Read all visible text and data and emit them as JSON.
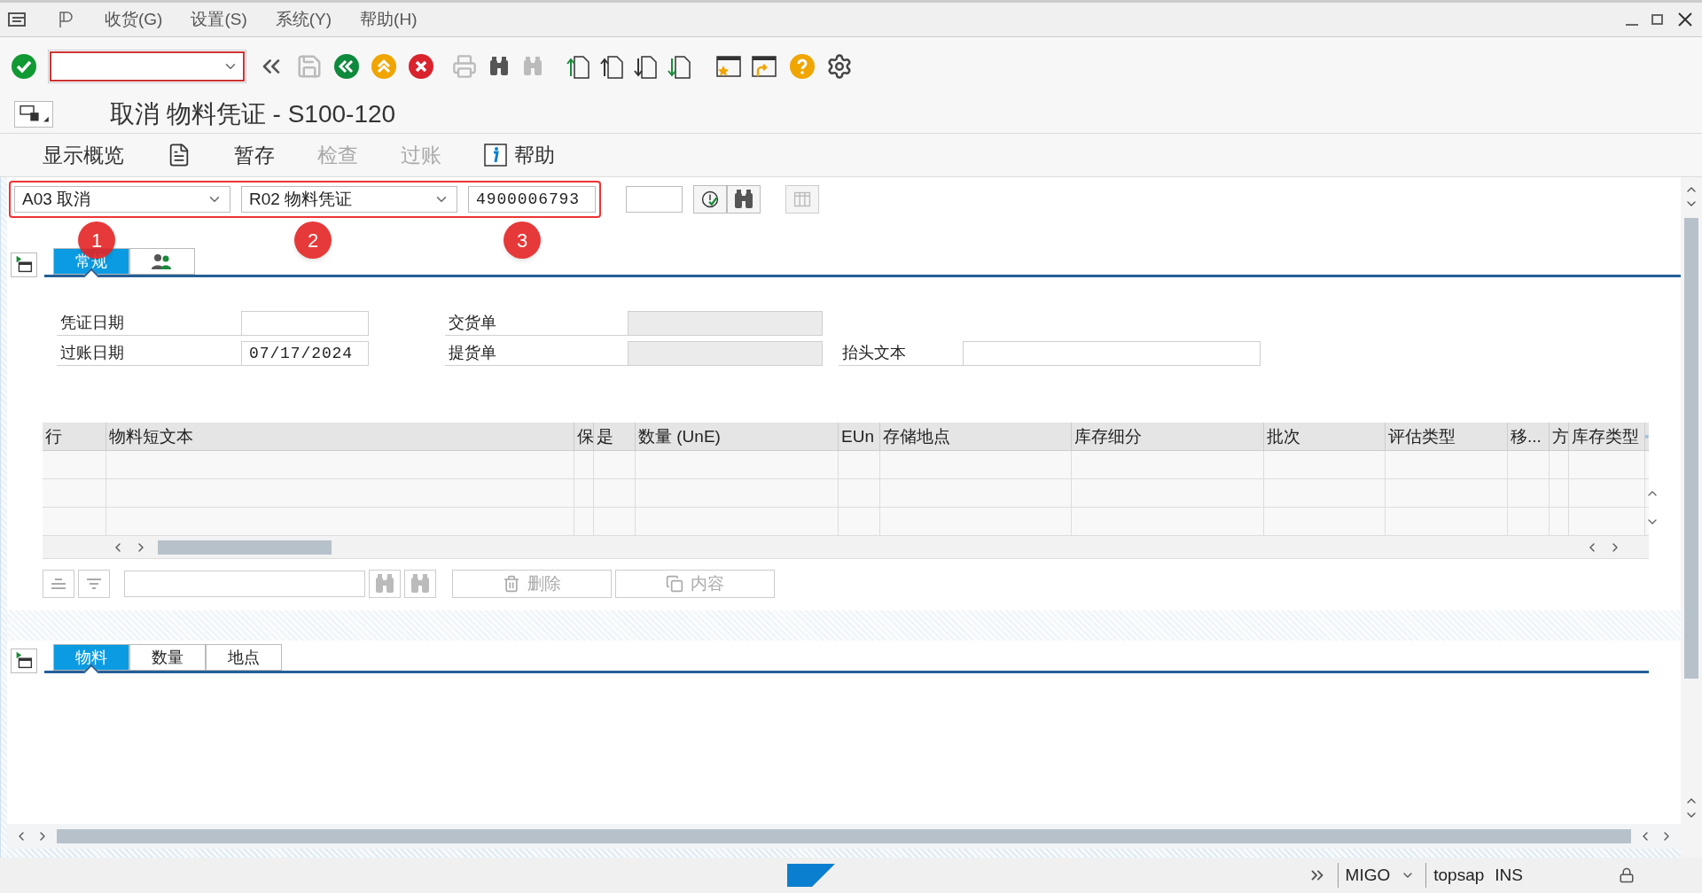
{
  "menu_bar": {
    "items": [
      {
        "label": "收货(G)"
      },
      {
        "label": "设置(S)"
      },
      {
        "label": "系统(Y)"
      },
      {
        "label": "帮助(H)"
      }
    ]
  },
  "title": "取消 物料凭证 - S100-120",
  "app_toolbar": [
    {
      "kind": "text",
      "label": "显示概览",
      "disabled": false
    },
    {
      "kind": "icon",
      "disabled": false
    },
    {
      "kind": "text",
      "label": "暂存",
      "disabled": false
    },
    {
      "kind": "text",
      "label": "检查",
      "disabled": true
    },
    {
      "kind": "text",
      "label": "过账",
      "disabled": true
    },
    {
      "kind": "info",
      "label": "帮助",
      "disabled": false
    }
  ],
  "header_fields": {
    "action": "A03 取消",
    "reference": "R02 物料凭证",
    "document_number": "4900006793"
  },
  "annotations": [
    {
      "label": "1"
    },
    {
      "label": "2"
    },
    {
      "label": "3"
    }
  ],
  "header_tabs": [
    {
      "kind": "text",
      "label": "常规",
      "selected": true
    },
    {
      "kind": "icon",
      "selected": false
    }
  ],
  "general_fields": [
    {
      "label": "凭证日期",
      "disabled": false
    },
    {
      "label": "过账日期",
      "value": "07/17/2024",
      "disabled": false
    },
    {
      "label": "交货单",
      "disabled": true
    },
    {
      "label": "提货单",
      "disabled": true
    },
    {
      "label": "抬头文本",
      "disabled": false
    }
  ],
  "items_table": {
    "columns": [
      "行",
      "物料短文本",
      "保",
      "是",
      "数量 (UnE)",
      "EUn",
      "存储地点",
      "库存细分",
      "批次",
      "评估类型",
      "移...",
      "方",
      "库存类型"
    ],
    "buttons": [
      {
        "label": "删除",
        "disabled": true
      },
      {
        "label": "内容",
        "disabled": true
      }
    ]
  },
  "detail_tabs": [
    {
      "label": "物料",
      "selected": true
    },
    {
      "label": "数量",
      "selected": false
    },
    {
      "label": "地点",
      "selected": false
    }
  ],
  "status_bar": {
    "transaction": "MIGO",
    "system": "topsap",
    "mode": "INS"
  }
}
